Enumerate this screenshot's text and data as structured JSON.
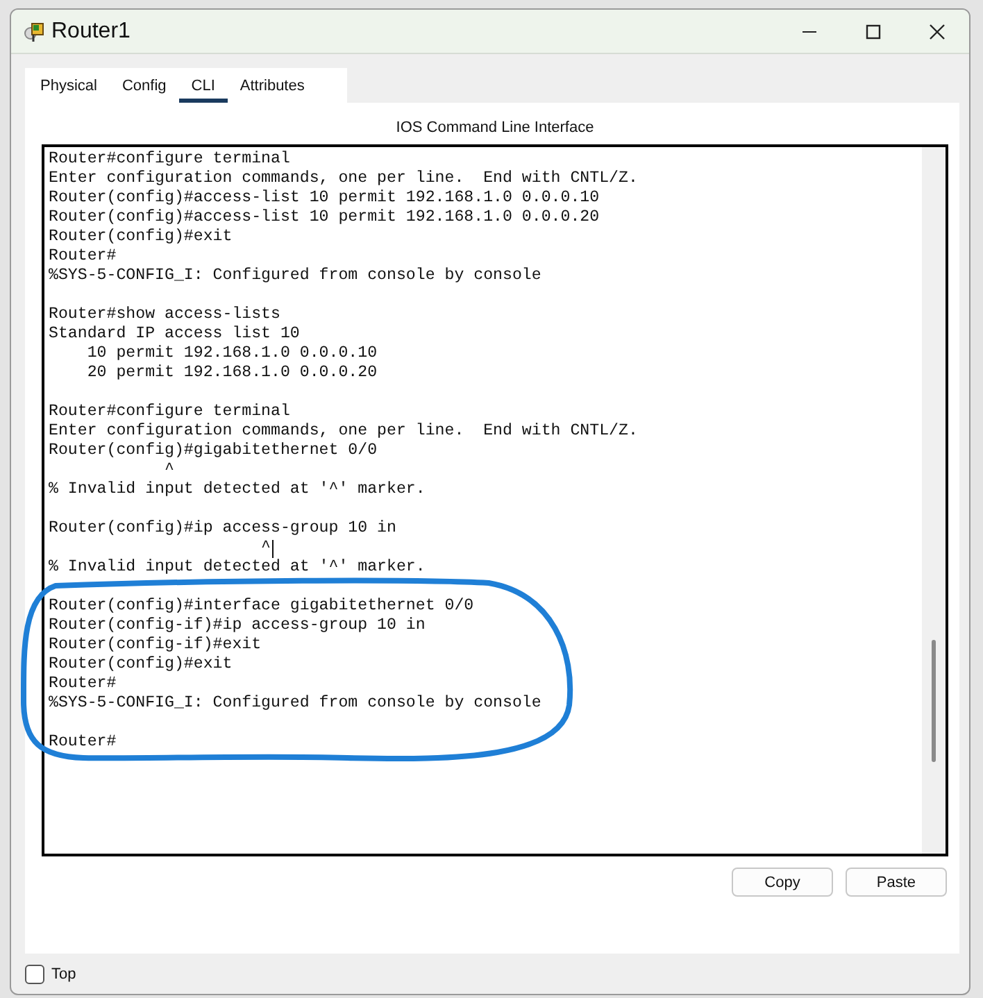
{
  "window": {
    "title": "Router1"
  },
  "tabs": [
    {
      "label": "Physical",
      "selected": false
    },
    {
      "label": "Config",
      "selected": false
    },
    {
      "label": "CLI",
      "selected": true
    },
    {
      "label": "Attributes",
      "selected": false
    }
  ],
  "panel_title": "IOS Command Line Interface",
  "terminal": {
    "blocks": [
      [
        "Router#configure terminal",
        "Enter configuration commands, one per line.  End with CNTL/Z.",
        "Router(config)#access-list 10 permit 192.168.1.0 0.0.0.10",
        "Router(config)#access-list 10 permit 192.168.1.0 0.0.0.20",
        "Router(config)#exit",
        "Router#",
        "%SYS-5-CONFIG_I: Configured from console by console"
      ],
      [
        "Router#show access-lists",
        "Standard IP access list 10",
        "    10 permit 192.168.1.0 0.0.0.10",
        "    20 permit 192.168.1.0 0.0.0.20"
      ],
      [
        "Router#configure terminal",
        "Enter configuration commands, one per line.  End with CNTL/Z.",
        "Router(config)#gigabitethernet 0/0",
        "            ^",
        "% Invalid input detected at '^' marker."
      ],
      [
        "Router(config)#ip access-group 10 in",
        "                      ^",
        "% Invalid input detected at '^' marker."
      ],
      [
        "Router(config)#interface gigabitethernet 0/0",
        "Router(config-if)#ip access-group 10 in",
        "Router(config-if)#exit",
        "Router(config)#exit",
        "Router#",
        "%SYS-5-CONFIG_I: Configured from console by console"
      ],
      [
        "Router#"
      ]
    ]
  },
  "buttons": [
    "Copy",
    "Paste"
  ],
  "top_checkbox": {
    "label": "Top",
    "checked": false
  }
}
